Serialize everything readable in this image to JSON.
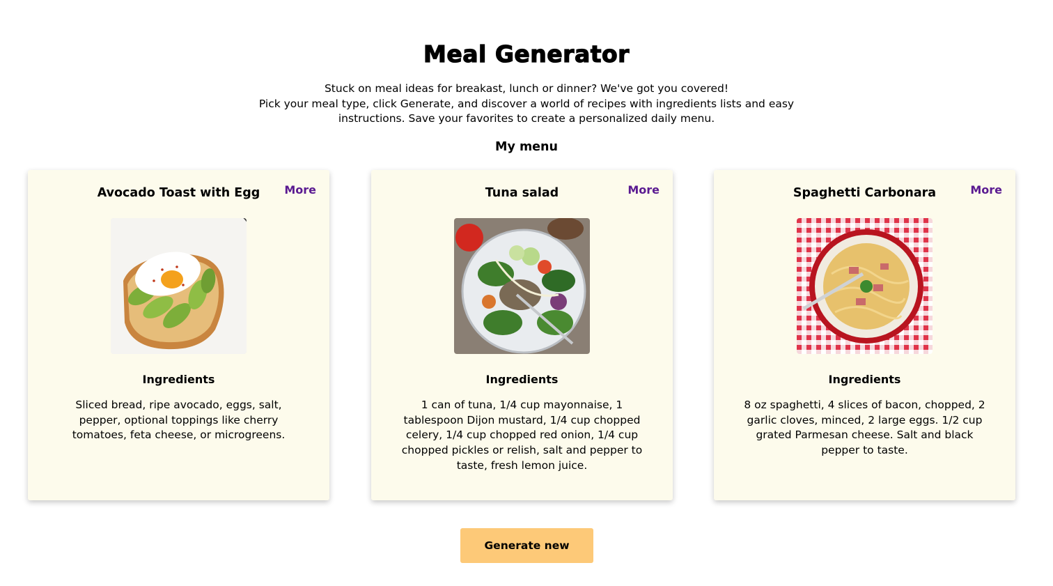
{
  "header": {
    "title": "Meal Generator",
    "intro_line1": "Stuck on meal ideas for breakast, lunch or dinner? We've got you covered!",
    "intro_line2": "Pick your meal type, click Generate, and discover a world of recipes with ingredients lists and easy instructions. Save your favorites to create a personalized daily menu.",
    "menu_heading": "My menu"
  },
  "cards": [
    {
      "title": "Avocado Toast with Egg",
      "more_label": "More",
      "ingredients_heading": "Ingredients",
      "ingredients": "Sliced bread, ripe avocado, eggs, salt, pepper, optional toppings like cherry tomatoes, feta cheese, or microgreens."
    },
    {
      "title": "Tuna salad",
      "more_label": "More",
      "ingredients_heading": "Ingredients",
      "ingredients": "1 can of tuna, 1/4 cup mayonnaise, 1 tablespoon Dijon mustard, 1/4 cup chopped celery, 1/4 cup chopped red onion, 1/4 cup chopped pickles or relish, salt and pepper to taste, fresh lemon juice."
    },
    {
      "title": "Spaghetti Carbonara",
      "more_label": "More",
      "ingredients_heading": "Ingredients",
      "ingredients": "8 oz spaghetti, 4 slices of bacon, chopped, 2 garlic cloves, minced, 2 large eggs. 1/2 cup grated Parmesan cheese. Salt and black pepper to taste."
    }
  ],
  "actions": {
    "generate_label": "Generate new"
  },
  "colors": {
    "card_background": "#fdfbec",
    "link": "#5a1a91",
    "button": "#fdc978"
  }
}
